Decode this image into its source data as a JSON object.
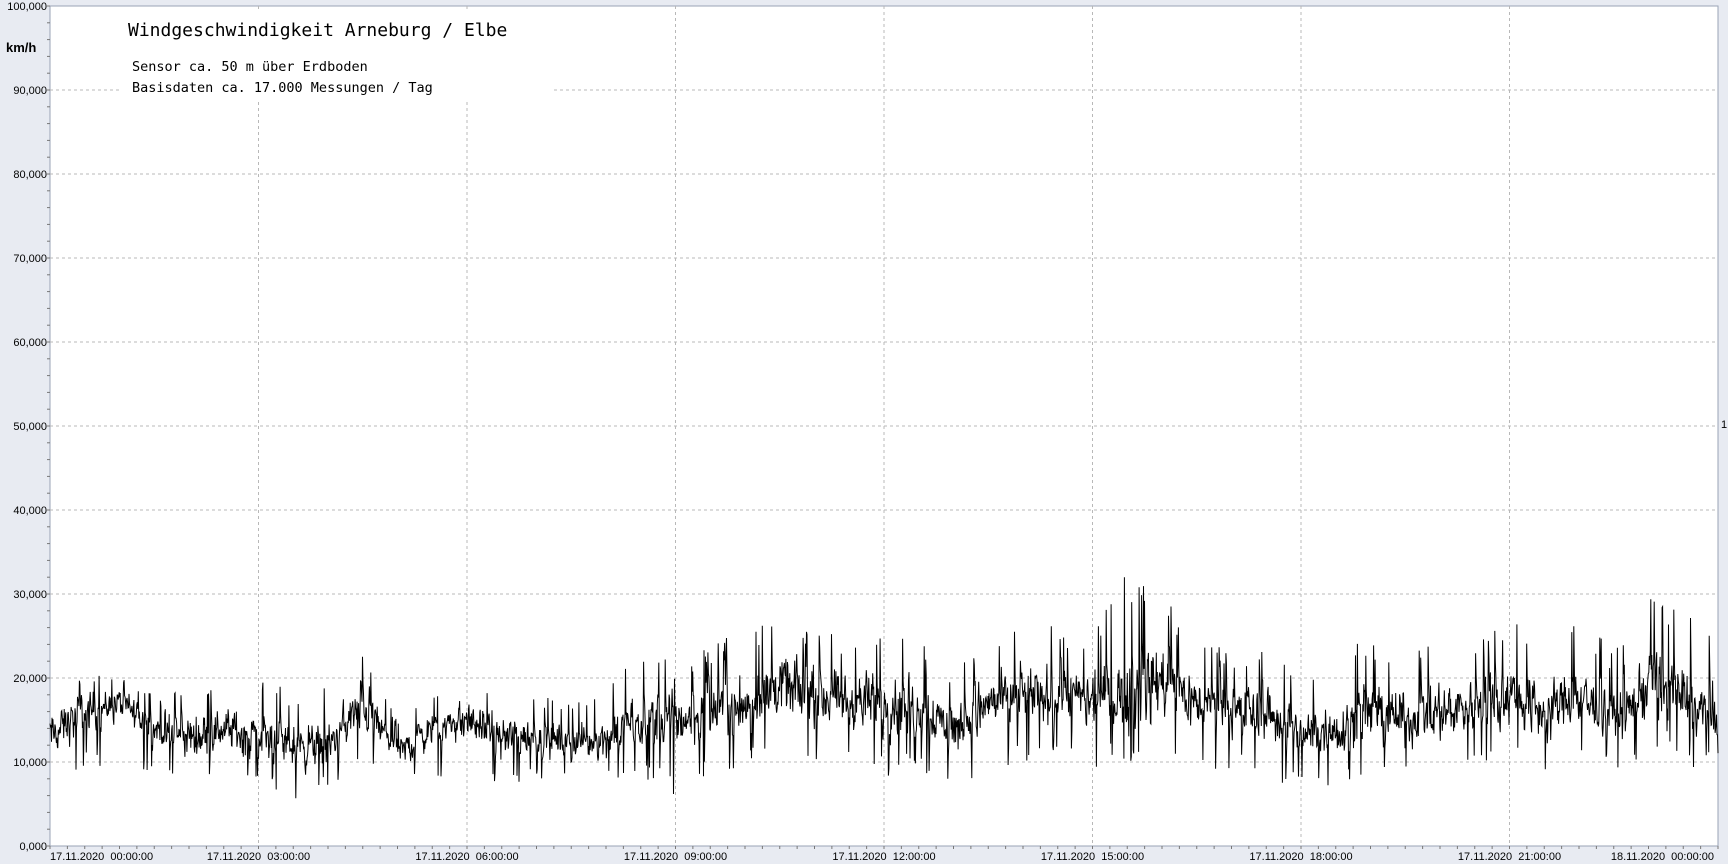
{
  "chart_data": {
    "type": "line",
    "title": "Windgeschwindigkeit  Arneburg / Elbe",
    "subtitle_lines": [
      "Sensor ca. 50 m über Erdboden",
      "Basisdaten ca. 17.000 Messungen / Tag"
    ],
    "ylabel": "km/h",
    "ylim": [
      0,
      100
    ],
    "xlim_hours": [
      0,
      24
    ],
    "grid": true,
    "y_ticks": [
      "0,000",
      "10,000",
      "20,000",
      "30,000",
      "40,000",
      "50,000",
      "60,000",
      "70,000",
      "80,000",
      "90,000",
      "100,000"
    ],
    "x_ticks": [
      "17.11.2020  00:00:00",
      "17.11.2020  03:00:00",
      "17.11.2020  06:00:00",
      "17.11.2020  09:00:00",
      "17.11.2020  12:00:00",
      "17.11.2020  15:00:00",
      "17.11.2020  18:00:00",
      "17.11.2020  21:00:00",
      "18.11.2020  00:00:00"
    ],
    "right_edge_label": "1",
    "series": [
      {
        "x_hours": [
          0,
          0.5,
          1.0,
          1.5,
          2.0,
          2.5,
          3.0,
          3.5,
          4.0,
          4.5,
          5.0,
          5.5,
          6.0,
          6.5,
          7.0,
          7.5,
          8.0,
          8.5,
          9.0,
          9.5,
          10.0,
          10.5,
          11.0,
          11.5,
          12.0,
          12.5,
          13.0,
          13.5,
          14.0,
          14.5,
          15.0,
          15.5,
          16.0,
          16.5,
          17.0,
          17.5,
          18.0,
          18.5,
          19.0,
          19.5,
          20.0,
          20.5,
          21.0,
          21.5,
          22.0,
          22.5,
          23.0,
          23.5,
          24.0
        ],
        "mean": [
          13,
          16,
          17,
          14,
          13,
          14,
          13,
          12,
          12,
          17,
          11,
          14,
          15,
          13,
          13,
          12,
          13,
          15,
          15,
          16,
          17,
          19,
          18,
          17,
          17,
          17,
          14,
          17,
          18,
          18,
          17,
          18,
          20,
          17,
          16,
          16,
          13,
          14,
          16,
          15,
          16,
          17,
          18,
          16,
          18,
          15,
          19,
          18,
          14
        ],
        "min": [
          6,
          9,
          10,
          8,
          7,
          7,
          7,
          4.5,
          7,
          10,
          7,
          8,
          9,
          7,
          8,
          7,
          8,
          8,
          6,
          8,
          9,
          10,
          9,
          9,
          8,
          9,
          5.5,
          9,
          10,
          10,
          9,
          9,
          9,
          9,
          9,
          8,
          6.5,
          7,
          9,
          8,
          9,
          9,
          10,
          9,
          10,
          9,
          11,
          10,
          7
        ],
        "max": [
          19,
          21,
          20,
          18,
          20,
          19,
          21,
          18,
          19,
          24.5,
          15,
          19,
          19.5,
          18,
          18,
          17,
          19,
          23,
          22,
          24,
          26,
          27,
          26,
          25,
          25,
          25,
          20,
          26,
          27,
          26,
          25,
          34,
          30,
          25,
          23,
          24,
          21,
          23,
          25,
          23,
          25,
          24,
          27,
          25,
          28,
          23,
          31,
          28,
          27
        ]
      }
    ]
  }
}
